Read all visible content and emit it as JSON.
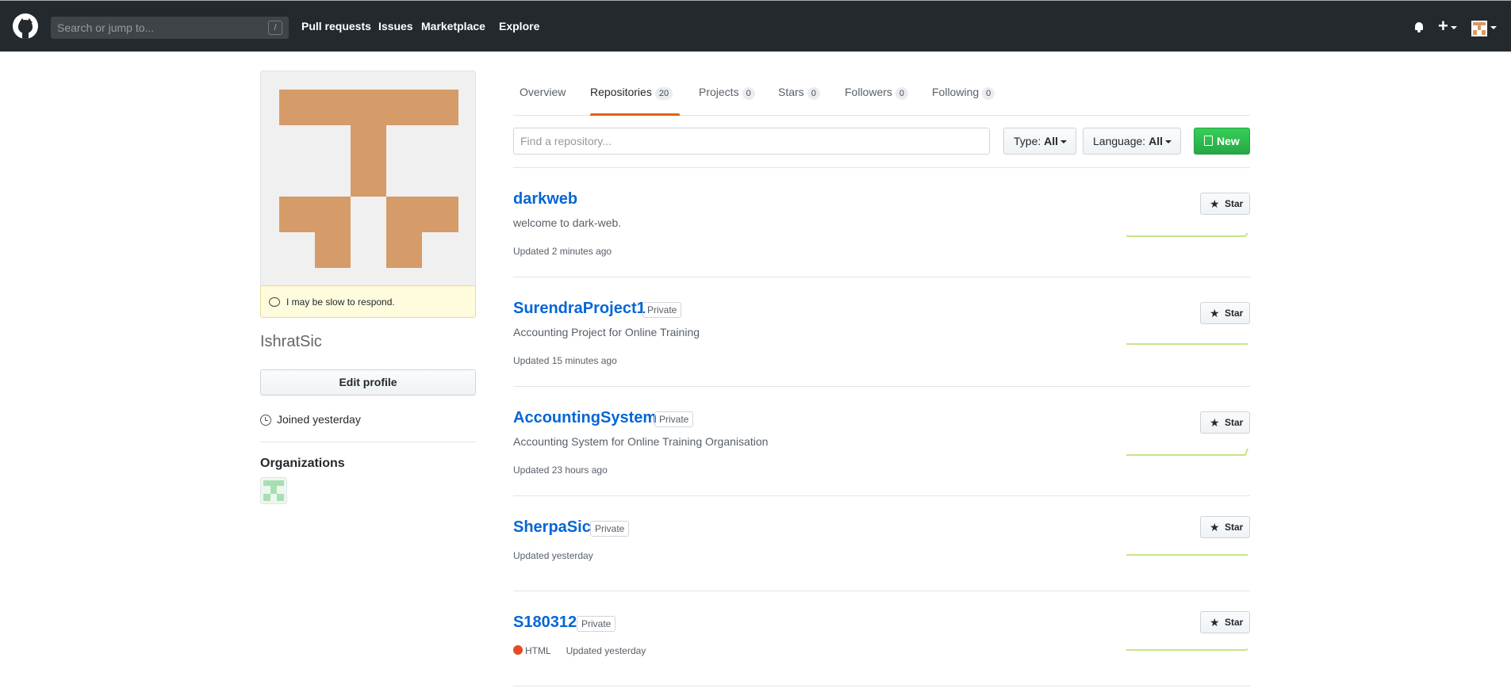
{
  "header": {
    "search_placeholder": "Search or jump to...",
    "search_shortcut": "/",
    "nav": [
      "Pull requests",
      "Issues",
      "Marketplace",
      "Explore"
    ]
  },
  "sidebar": {
    "status": "I may be slow to respond.",
    "username": "IshratSic",
    "edit_profile": "Edit profile",
    "joined": "Joined yesterday",
    "organizations_title": "Organizations"
  },
  "tabs": [
    {
      "label": "Overview",
      "count": null
    },
    {
      "label": "Repositories",
      "count": "20"
    },
    {
      "label": "Projects",
      "count": "0"
    },
    {
      "label": "Stars",
      "count": "0"
    },
    {
      "label": "Followers",
      "count": "0"
    },
    {
      "label": "Following",
      "count": "0"
    }
  ],
  "filters": {
    "find_placeholder": "Find a repository...",
    "type_label": "Type:",
    "type_value": "All",
    "language_label": "Language:",
    "language_value": "All",
    "new_label": "New"
  },
  "repos": [
    {
      "name": "darkweb",
      "private": null,
      "description": "welcome to dark-web.",
      "language": null,
      "updated": "Updated 2 minutes ago",
      "star": "Star"
    },
    {
      "name": "SurendraProject1",
      "private": "Private",
      "description": "Accounting Project for Online Training",
      "language": null,
      "updated": "Updated 15 minutes ago",
      "star": "Star"
    },
    {
      "name": "AccountingSystem",
      "private": "Private",
      "description": "Accounting System for Online Training Organisation",
      "language": null,
      "updated": "Updated 23 hours ago",
      "star": "Star"
    },
    {
      "name": "SherpaSic",
      "private": "Private",
      "description": null,
      "language": null,
      "updated": "Updated yesterday",
      "star": "Star"
    },
    {
      "name": "S180312",
      "private": "Private",
      "description": null,
      "language": "HTML",
      "updated": "Updated yesterday",
      "star": "Star"
    }
  ],
  "colors": {
    "header_bg": "#24292e",
    "link": "#0366d6",
    "tab_underline": "#e36209",
    "new_button": "#28a745",
    "avatar": "#d59b69",
    "html_language": "#e34c26",
    "sparkline": "#c6e48b"
  }
}
